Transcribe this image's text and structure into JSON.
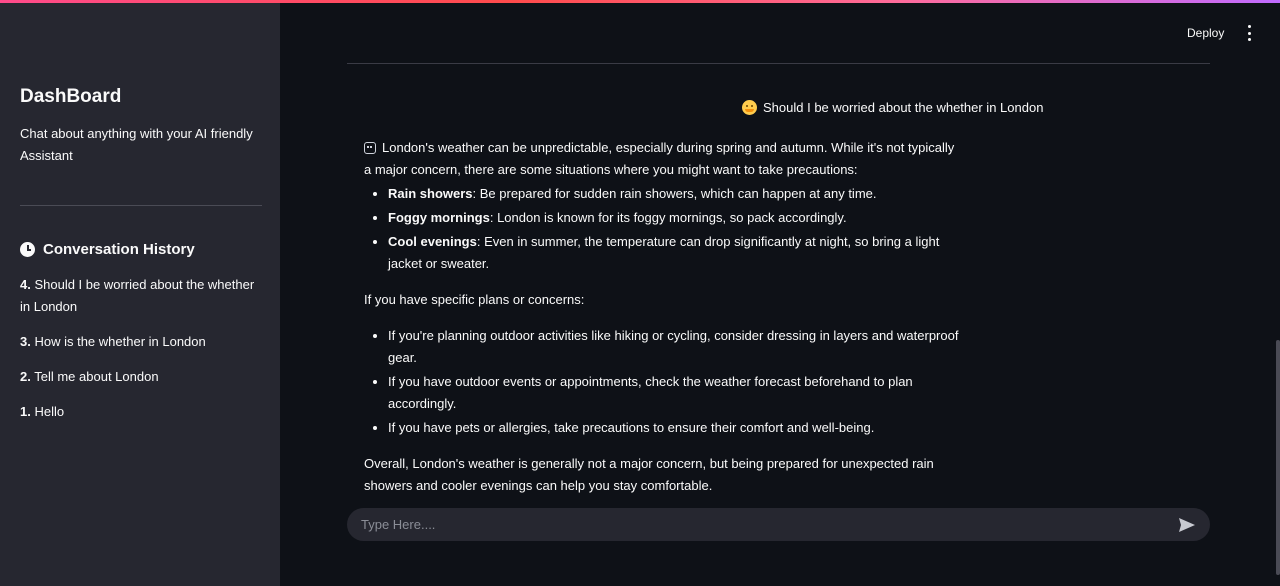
{
  "sidebar": {
    "title": "DashBoard",
    "subtitle": "Chat about anything with your AI friendly Assistant",
    "history_header": "Conversation History",
    "history": [
      {
        "num": "4.",
        "text": "Should I be worried about the whether in London"
      },
      {
        "num": "3.",
        "text": "How is the whether in London"
      },
      {
        "num": "2.",
        "text": "Tell me about London"
      },
      {
        "num": "1.",
        "text": "Hello"
      }
    ]
  },
  "header": {
    "deploy_label": "Deploy"
  },
  "chat": {
    "user_message": "Should I be worried about the whether in London",
    "assistant": {
      "intro": "London's weather can be unpredictable, especially during spring and autumn. While it's not typically a major concern, there are some situations where you might want to take precautions:",
      "bullets1": [
        {
          "bold": "Rain showers",
          "rest": ": Be prepared for sudden rain showers, which can happen at any time."
        },
        {
          "bold": "Foggy mornings",
          "rest": ": London is known for its foggy mornings, so pack accordingly."
        },
        {
          "bold": "Cool evenings",
          "rest": ": Even in summer, the temperature can drop significantly at night, so bring a light jacket or sweater."
        }
      ],
      "plans_intro": "If you have specific plans or concerns:",
      "bullets2": [
        "If you're planning outdoor activities like hiking or cycling, consider dressing in layers and waterproof gear.",
        "If you have outdoor events or appointments, check the weather forecast beforehand to plan accordingly.",
        "If you have pets or allergies, take precautions to ensure their comfort and well-being."
      ],
      "conclusion": "Overall, London's weather is generally not a major concern, but being prepared for unexpected rain showers and cooler evenings can help you stay comfortable."
    }
  },
  "input": {
    "placeholder": "Type Here...."
  },
  "colors": {
    "sidebar_bg": "#262730",
    "main_bg": "#0e1117",
    "text": "#fafafa"
  }
}
